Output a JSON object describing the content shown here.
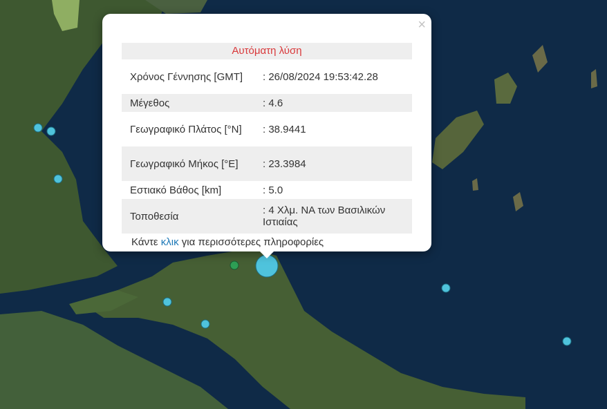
{
  "popup": {
    "title": "Αυτόματη λύση",
    "close_icon": "close-icon",
    "rows": [
      {
        "label": "Χρόνος Γέννησης [GMT]",
        "value": ": 26/08/2024 19:53:42.28"
      },
      {
        "label": "Μέγεθος",
        "value": ": 4.6"
      },
      {
        "label": "Γεωγραφικό Πλάτος [°N]",
        "value": ": 38.9441"
      },
      {
        "label": "Γεωγραφικό Μήκος [°E]",
        "value": ": 23.3984"
      },
      {
        "label": "Εστιακό Βάθος [km]",
        "value": ": 5.0"
      },
      {
        "label": "Τοποθεσία",
        "value": ": 4 Χλμ. ΝΑ των Βασιλικών Ιστιαίας"
      }
    ],
    "more_prefix": "Κάντε ",
    "more_link": "κλικ",
    "more_suffix": " για περισσότερες πληροφορίες"
  },
  "colors": {
    "sea": "#0f2a47",
    "land": "#3f5a2c",
    "marker": "#4fc3dc",
    "marker_green": "#2e9f55",
    "title_red": "#d9383a",
    "link": "#1f7ab8"
  }
}
